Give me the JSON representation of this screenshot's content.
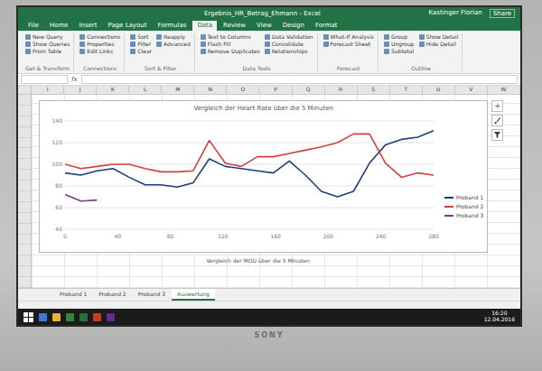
{
  "window": {
    "title": "Ergebnis_HR_Betrag_Ehmann - Excel",
    "user": "Kastinger Florian",
    "share": "Share"
  },
  "ribbon": {
    "tabs": [
      {
        "label": "File",
        "selected": false
      },
      {
        "label": "Home",
        "selected": false
      },
      {
        "label": "Insert",
        "selected": false
      },
      {
        "label": "Page Layout",
        "selected": false
      },
      {
        "label": "Formulas",
        "selected": false
      },
      {
        "label": "Data",
        "selected": true
      },
      {
        "label": "Review",
        "selected": false
      },
      {
        "label": "View",
        "selected": false
      },
      {
        "label": "Design",
        "selected": false
      },
      {
        "label": "Format",
        "selected": false
      }
    ],
    "groups": [
      {
        "label": "Get & Transform",
        "buttons": [
          "New Query",
          "Show Queries",
          "From Table"
        ]
      },
      {
        "label": "Connections",
        "buttons": [
          "Connections",
          "Properties",
          "Edit Links"
        ]
      },
      {
        "label": "Sort & Filter",
        "buttons": [
          "Sort",
          "Filter",
          "Clear",
          "Reapply",
          "Advanced"
        ]
      },
      {
        "label": "Data Tools",
        "buttons": [
          "Text to Columns",
          "Flash Fill",
          "Remove Duplicates",
          "Data Validation",
          "Consolidate",
          "Relationships"
        ]
      },
      {
        "label": "Forecast",
        "buttons": [
          "What-If Analysis",
          "Forecast Sheet"
        ]
      },
      {
        "label": "Outline",
        "buttons": [
          "Group",
          "Ungroup",
          "Subtotal",
          "Show Detail",
          "Hide Detail"
        ]
      }
    ]
  },
  "formula_bar": {
    "fx": "fx"
  },
  "columns": [
    "I",
    "J",
    "K",
    "L",
    "M",
    "N",
    "O",
    "P",
    "Q",
    "R",
    "S",
    "T",
    "U",
    "V",
    "W"
  ],
  "chart": {
    "title": "Vergleich der Heart Rate über die 5 Minuten",
    "y_ticks": [
      "40",
      "60",
      "80",
      "100",
      "120",
      "140"
    ],
    "x_ticks": [
      "0",
      "40",
      "80",
      "120",
      "160",
      "200",
      "240",
      "280"
    ],
    "series": [
      {
        "name": "Proband 1",
        "color": "#1f3f7a",
        "values": [
          92,
          90,
          94,
          96,
          88,
          81,
          81,
          79,
          83,
          105,
          98,
          96,
          94,
          92,
          103,
          90,
          75,
          70,
          75,
          101,
          118,
          123,
          125,
          131
        ]
      },
      {
        "name": "Proband 2",
        "color": "#d04040",
        "values": [
          100,
          96,
          98,
          100,
          100,
          96,
          93,
          93,
          94,
          122,
          101,
          98,
          107,
          107,
          110,
          113,
          116,
          120,
          128,
          128,
          101,
          88,
          92,
          90
        ]
      },
      {
        "name": "Proband 3",
        "color": "#7a3b8f",
        "values": [
          72,
          66,
          67
        ]
      }
    ],
    "tools": [
      "+"
    ]
  },
  "second_chart": {
    "title": "Vergleich der MOD über die 5 Minuten"
  },
  "sheet_tabs": [
    {
      "label": "Proband 1",
      "selected": false
    },
    {
      "label": "Proband 2",
      "selected": false
    },
    {
      "label": "Proband 3",
      "selected": false
    },
    {
      "label": "Auswertung",
      "selected": true
    }
  ],
  "taskbar": {
    "time": "16:20",
    "date": "12.04.2016"
  },
  "monitor": {
    "brand": "SONY"
  }
}
